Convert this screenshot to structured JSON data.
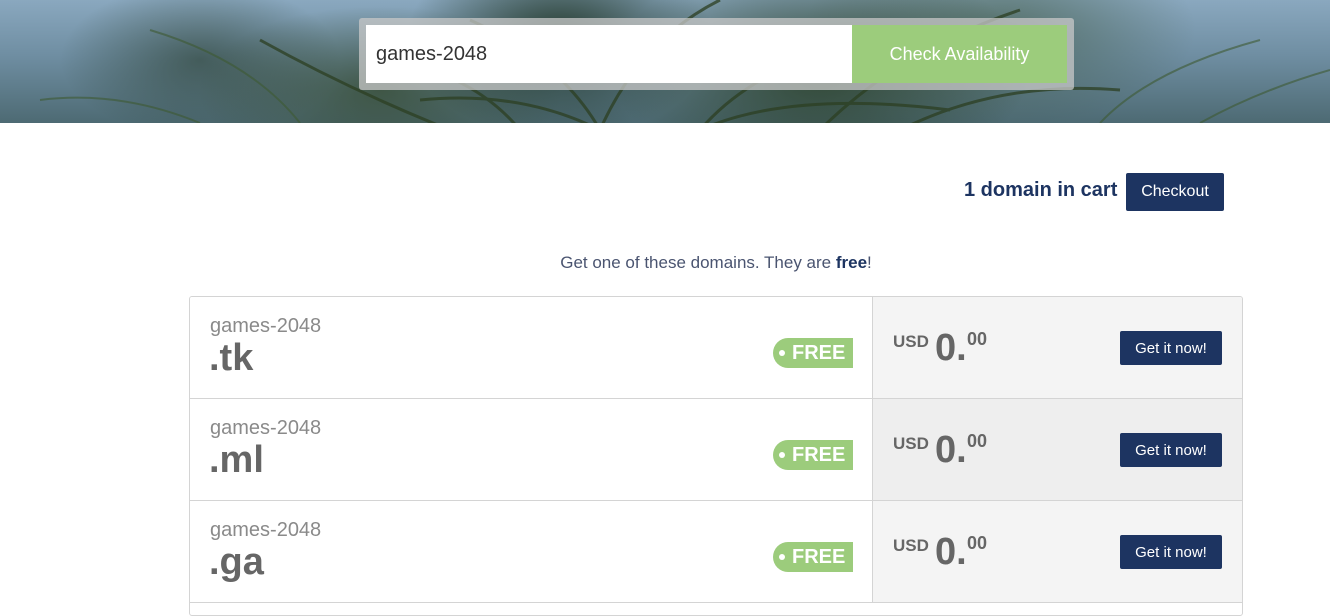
{
  "search": {
    "value": "games-2048",
    "button_label": "Check Availability"
  },
  "cart": {
    "status": "1 domain in cart",
    "checkout_label": "Checkout"
  },
  "promo": {
    "text_before": "Get one of these domains. They are ",
    "text_bold": "free",
    "text_after": "!"
  },
  "domains": [
    {
      "name": "games-2048",
      "tld": ".tk",
      "badge": "FREE",
      "currency": "USD",
      "price_int": "0.",
      "price_dec": "00",
      "button": "Get it now!"
    },
    {
      "name": "games-2048",
      "tld": ".ml",
      "badge": "FREE",
      "currency": "USD",
      "price_int": "0.",
      "price_dec": "00",
      "button": "Get it now!"
    },
    {
      "name": "games-2048",
      "tld": ".ga",
      "badge": "FREE",
      "currency": "USD",
      "price_int": "0.",
      "price_dec": "00",
      "button": "Get it now!"
    }
  ],
  "colors": {
    "accent_green": "#9ccc7c",
    "navy": "#1d3461",
    "right_bg_rows": [
      "#f4f4f4",
      "#eeeeee",
      "#f4f4f4"
    ]
  }
}
